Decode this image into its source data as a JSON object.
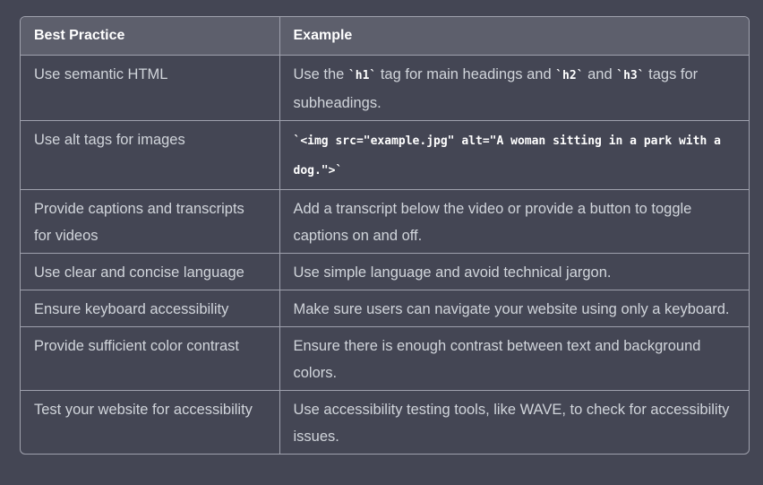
{
  "table": {
    "headers": [
      "Best Practice",
      "Example"
    ],
    "rows": [
      {
        "practice": "Use semantic HTML",
        "parts": [
          "Use the ",
          "`h1`",
          " tag for main headings and ",
          "`h2`",
          " and ",
          "`h3`",
          " tags for subheadings."
        ]
      },
      {
        "practice": "Use alt tags for images",
        "code": "`<img src=\"example.jpg\" alt=\"A woman sitting in a park with a dog.\">`"
      },
      {
        "practice": "Provide captions and transcripts for videos",
        "example": "Add a transcript below the video or provide a button to toggle captions on and off."
      },
      {
        "practice": "Use clear and concise language",
        "example": "Use simple language and avoid technical jargon."
      },
      {
        "practice": "Ensure keyboard accessibility",
        "example": "Make sure users can navigate your website using only a keyboard."
      },
      {
        "practice": "Provide sufficient color contrast",
        "example": "Ensure there is enough contrast between text and background colors."
      },
      {
        "practice": "Test your website for accessibility",
        "example": "Use accessibility testing tools, like WAVE, to check for accessibility issues."
      }
    ]
  }
}
